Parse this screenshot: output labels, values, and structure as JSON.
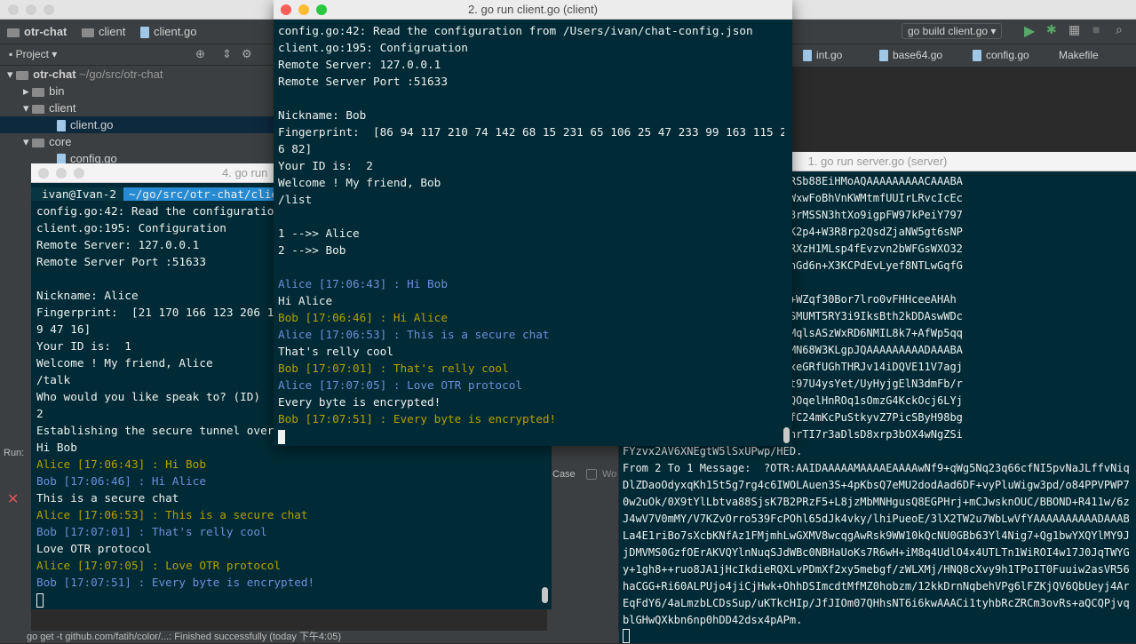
{
  "ide": {
    "project": "otr-chat",
    "crumbs": [
      "client",
      "client.go"
    ],
    "build_config": "go build client.go",
    "project_label": "Project",
    "tree": [
      {
        "label": "otr-chat",
        "extra": "~/go/src/otr-chat"
      },
      {
        "label": "bin"
      },
      {
        "label": "client"
      },
      {
        "label": "client.go"
      },
      {
        "label": "core"
      },
      {
        "label": "config.go"
      }
    ],
    "tabs": [
      "int.go",
      "base64.go",
      "config.go",
      "Makefile"
    ],
    "run_label": "Run:",
    "case_label": "Case",
    "wo_label": "Wo",
    "status": "go get -t github.com/fatih/color/...: Finished successfully (today 下午4:05)"
  },
  "windows": {
    "client_bob": {
      "title": "2. go run client.go (client)",
      "lines": [
        "config.go:42: Read the configuration from /Users/ivan/chat-config.json",
        "client.go:195: Configruation",
        "Remote Server: 127.0.0.1",
        "Remote Server Port :51633",
        "",
        "Nickname: Bob",
        "Fingerprint:  [86 94 117 210 74 142 68 15 231 65 106 25 47 233 99 163 115 229 12",
        "6 82]",
        "Your ID is:  2",
        "Welcome ! My friend, Bob",
        "/list",
        "",
        "1 -->> Alice",
        "2 -->> Bob",
        ""
      ],
      "chat": [
        {
          "who": "alice",
          "text": "Alice [17:06:43] : Hi Bob"
        },
        {
          "who": "self",
          "text": "Hi Alice"
        },
        {
          "who": "bob",
          "text": "Bob [17:06:46] : Hi Alice"
        },
        {
          "who": "alice",
          "text": "Alice [17:06:53] : This is a secure chat"
        },
        {
          "who": "self",
          "text": "That's relly cool"
        },
        {
          "who": "bob",
          "text": "Bob [17:07:01] : That's relly cool"
        },
        {
          "who": "alice",
          "text": "Alice [17:07:05] : Love OTR protocol"
        },
        {
          "who": "self",
          "text": "Every byte is encrypted!"
        },
        {
          "who": "bob",
          "text": "Bob [17:07:51] : Every byte is encrypted!"
        }
      ]
    },
    "client_alice": {
      "title": "4. go run",
      "prompt_user": "ivan@Ivan-2",
      "prompt_path": "~/go/src/otr-chat/clien",
      "lines": [
        "config.go:42: Read the configuration f",
        "client.go:195: Configuration",
        "Remote Server: 127.0.0.1",
        "Remote Server Port :51633",
        "",
        "Nickname: Alice",
        "Fingerprint:  [21 170 166 123 206 180",
        "9 47 16]",
        "Your ID is:  1",
        "Welcome ! My friend, Alice",
        "/talk",
        "Who would you like speak to? (ID)",
        "2",
        "Establishing the secure tunnel over OT",
        "Hi Bob"
      ],
      "chat": [
        {
          "who": "alice",
          "text": "Alice [17:06:43] : Hi Bob"
        },
        {
          "who": "bob",
          "text": "Bob [17:06:46] : Hi Alice"
        },
        {
          "who": "self",
          "text": "This is a secure chat"
        },
        {
          "who": "alice",
          "text": "Alice [17:06:53] : This is a secure chat"
        },
        {
          "who": "bob",
          "text": "Bob [17:07:01] : That's relly cool"
        },
        {
          "who": "self",
          "text": "Love OTR protocol"
        },
        {
          "who": "alice",
          "text": "Alice [17:07:05] : Love OTR protocol"
        },
        {
          "who": "bob",
          "text": "Bob [17:07:51] : Every byte is encrypted!"
        }
      ]
    },
    "server": {
      "title": "1. go run server.go (server)",
      "lines": [
        "cnz4w9FqqM1Sc2WiEbAIUwdjdYRSb88EiHMoAQAAAAAAAAACAAABA",
        "gvSLHwH/DQZm6Lx1AFTKGRmPGEWxwFoBhVnKWMtmfUUIrLRvcIcEc",
        "J+SBOHuDAiiBDFudwSok3lchC88rMSSN3htXo9igpFW97kPeiY797",
        "DIyQUzqE9RKWEf2DZdJeed9N8GK2p4+W3R8rp2QsdZjaNW5gt6sNP",
        "eJaXMkbDaMl4LV515yx4PQlVwcRXzH1MLsp4fEvzvn2bWFGsWXO32",
        "FEXUWdwEWAwnbzkkv7Lg9AAAAChGd6n+X3KCPdEvLyef8NTLwGqfG",
        "",
        "AAIDAAAAAMAAAADAAAAwEeboCb+WZqf30Bor7lro0vFHHceeAHAh",
        "NeRpQ0gL37s7LWBgVR4arp3AXmSMUMT5RY3i9IksBth2kDDAswWDc",
        "czQt1gE4oEWi+9laFQmJxroyI0MqlsASzWxRD6NMIL8k7+AfWp5qq",
        "hrOat1FGhpaYJ9x2CUVmClVKNCMN68W3KLgpJQAAAAAAAAADAAABA",
        "Fak0Z5xYoif2Zs/f1cosqaYARkxeGRfUGhTHRJv14iDQVE11V7agj",
        "PeSCxAmGybn7erwByDqwFWT0sct97U4ysYet/UyHyjgElN3dmFb/r",
        "TG8ynKNPvOPGGW6nXNHpEaWnuuQOqelHnROq1sOmzG4KckOcj6LYj",
        "/csrGRXwNshLQQE3OGihKxiTp8fC24mKcPuStkyvZ7PicSByH98bg",
        "34PqdZQczHxM4xvXX3A8RgAAAChrTI7r3aDlsD8xrp3bOX4wNgZSi",
        "FYzvx2AV6XNEgtW5lSxUPwp/HED.",
        "From 2 To 1 Message:  ?OTR:AAIDAAAAAMAAAAEAAAAwNf9+qWg5Nq23q66cfNI5pvNaJLffvNiq",
        "DlZDaoOdyxqKh15t5g7rg4c6IWOLAuen3S+4pKbsQ7eMU2dodAad6DF+vyPluWigw3pd/o84PPVPWP7M",
        "0w2uOk/0X9tYlLbtva88SjsK7B2PRzF5+L8jzMbMNHgusQ8EGPHrj+mCJwsknOUC/BBOND+R411w/6zD",
        "J4wV7V0mMY/V7KZvOrro539FcPOhl65dJk4vky/lhiPueoE/3lX2TW2u7WbLwVfYAAAAAAAAAADAAABA",
        "La4E1riBo7sXcbKNfAz1FMjmhLwGXMV8wcqgAwRsk9WW10kQcNU0GBb63Yl4Nig7+Qg1bwYXQYlMY9JW",
        "jDMVMS0GzfOErAKVQYlnNuqSJdWBc0NBHaUoKs7R6wH+iM8q4UdlO4x4UTLTn1WiROI4w17J0JqTWYGv",
        "y+1gh8++ruo8JA1jHcIkdieRQXLvPDmXf2xy5mebgf/zWLXMj/HNQ8cXvy9h1TPoIT0Fuuiw2asVR56D",
        "haCGG+Ri60ALPUjo4jiCjHwk+OhhDSImcdtMfMZ0hobzm/12kkDrnNqbehVPg6lFZKjQV6QbUeyj4ArJ",
        "EqFdY6/4aLmzbLCDsSup/uKTkcHIp/JfJIOm07QHhsNT6i6kwAAACi1tyhbRcZRCm3ovRs+aQCQPjvqn",
        "blGHwQXkbn6np0hDD42dsx4pAPm."
      ]
    }
  },
  "colors": {
    "terminal_bg": "#002b36",
    "alice_color": "#8a9ee0",
    "bob_color": "#b58900"
  }
}
